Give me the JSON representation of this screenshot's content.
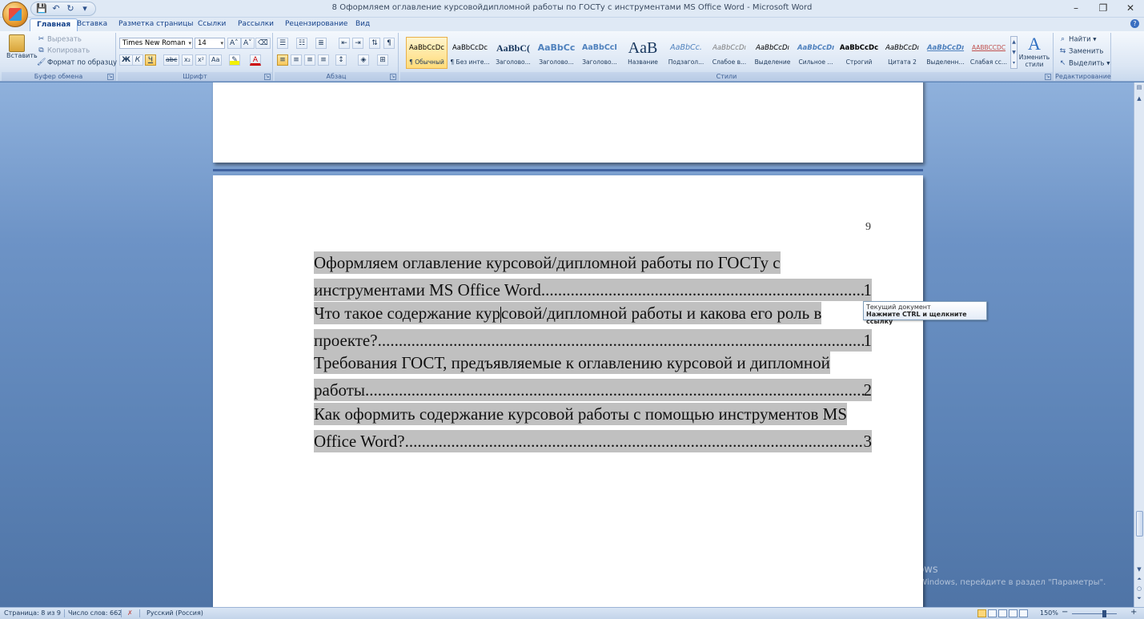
{
  "window": {
    "title": "8 Оформляем оглавление курсовойдипломной работы по ГОСТу с инструментами MS Office Word - Microsoft Word",
    "min": "–",
    "max": "❐",
    "close": "✕"
  },
  "tabs": [
    "Главная",
    "Вставка",
    "Разметка страницы",
    "Ссылки",
    "Рассылки",
    "Рецензирование",
    "Вид"
  ],
  "clipboard": {
    "paste": "Вставить",
    "cut": "Вырезать",
    "copy": "Копировать",
    "format_painter": "Формат по образцу",
    "label": "Буфер обмена"
  },
  "font": {
    "name": "Times New Roman",
    "size": "14",
    "label": "Шрифт",
    "bold": "Ж",
    "italic": "К",
    "underline": "Ч",
    "strike": "abc",
    "sub": "x₂",
    "sup": "x²",
    "case": "Aa",
    "grow": "A˄",
    "shrink": "A˅",
    "color": "A"
  },
  "paragraph": {
    "label": "Абзац"
  },
  "styles": {
    "label": "Стили",
    "items": [
      {
        "preview": "AaBbCcDc",
        "name": "¶ Обычный"
      },
      {
        "preview": "AaBbCcDc",
        "name": "¶ Без инте..."
      },
      {
        "preview": "AaBbC(",
        "name": "Заголово..."
      },
      {
        "preview": "AaBbCc",
        "name": "Заголово..."
      },
      {
        "preview": "AaBbCcI",
        "name": "Заголово..."
      },
      {
        "preview": "AaB",
        "name": "Название"
      },
      {
        "preview": "AaBbCc.",
        "name": "Подзагол..."
      },
      {
        "preview": "AaBbCcDı",
        "name": "Слабое в..."
      },
      {
        "preview": "AaBbCcDı",
        "name": "Выделение"
      },
      {
        "preview": "AaBbCcDı",
        "name": "Сильное ..."
      },
      {
        "preview": "AaBbCcDc",
        "name": "Строгий"
      },
      {
        "preview": "AaBbCcDı",
        "name": "Цитата 2"
      },
      {
        "preview": "AaBbCcDı",
        "name": "Выделенн..."
      },
      {
        "preview": "AABBCCDC",
        "name": "Слабая сс..."
      }
    ],
    "change": "Изменить стили"
  },
  "editing": {
    "label": "Редактирование",
    "find": "Найти",
    "replace": "Заменить",
    "select": "Выделить"
  },
  "document": {
    "page_number": "9",
    "toc": [
      {
        "line1": "Оформляем оглавление курсовой/дипломной работы по ГОСТу с",
        "line2": "инструментами MS Office Word",
        "page": "1"
      },
      {
        "line1a": "Что такое содержание кур",
        "line1b": "совой/дипломной работы и какова его роль в",
        "line2": "проекте?",
        "page": "1"
      },
      {
        "line1": "Требования ГОСТ, предъявляемые к оглавлению курсовой и дипломной",
        "line2": "работы",
        "page": "2"
      },
      {
        "line1": "Как оформить содержание курсовой работы с помощью инструментов MS",
        "line2": "Office Word?",
        "page": "3"
      }
    ],
    "dots": "......................................................................................................................................................................................"
  },
  "tooltip": {
    "line1": "Текущий документ",
    "line2": "Нажмите CTRL и щелкните ссылку"
  },
  "watermark": {
    "line1": "Активация Windows",
    "line2": "Чтобы активировать Windows, перейдите в раздел \"Параметры\"."
  },
  "status": {
    "page": "Страница: 8 из 9",
    "words": "Число слов: 662",
    "lang": "Русский (Россия)",
    "zoom": "150%",
    "zoom_minus": "−",
    "zoom_plus": "+"
  }
}
